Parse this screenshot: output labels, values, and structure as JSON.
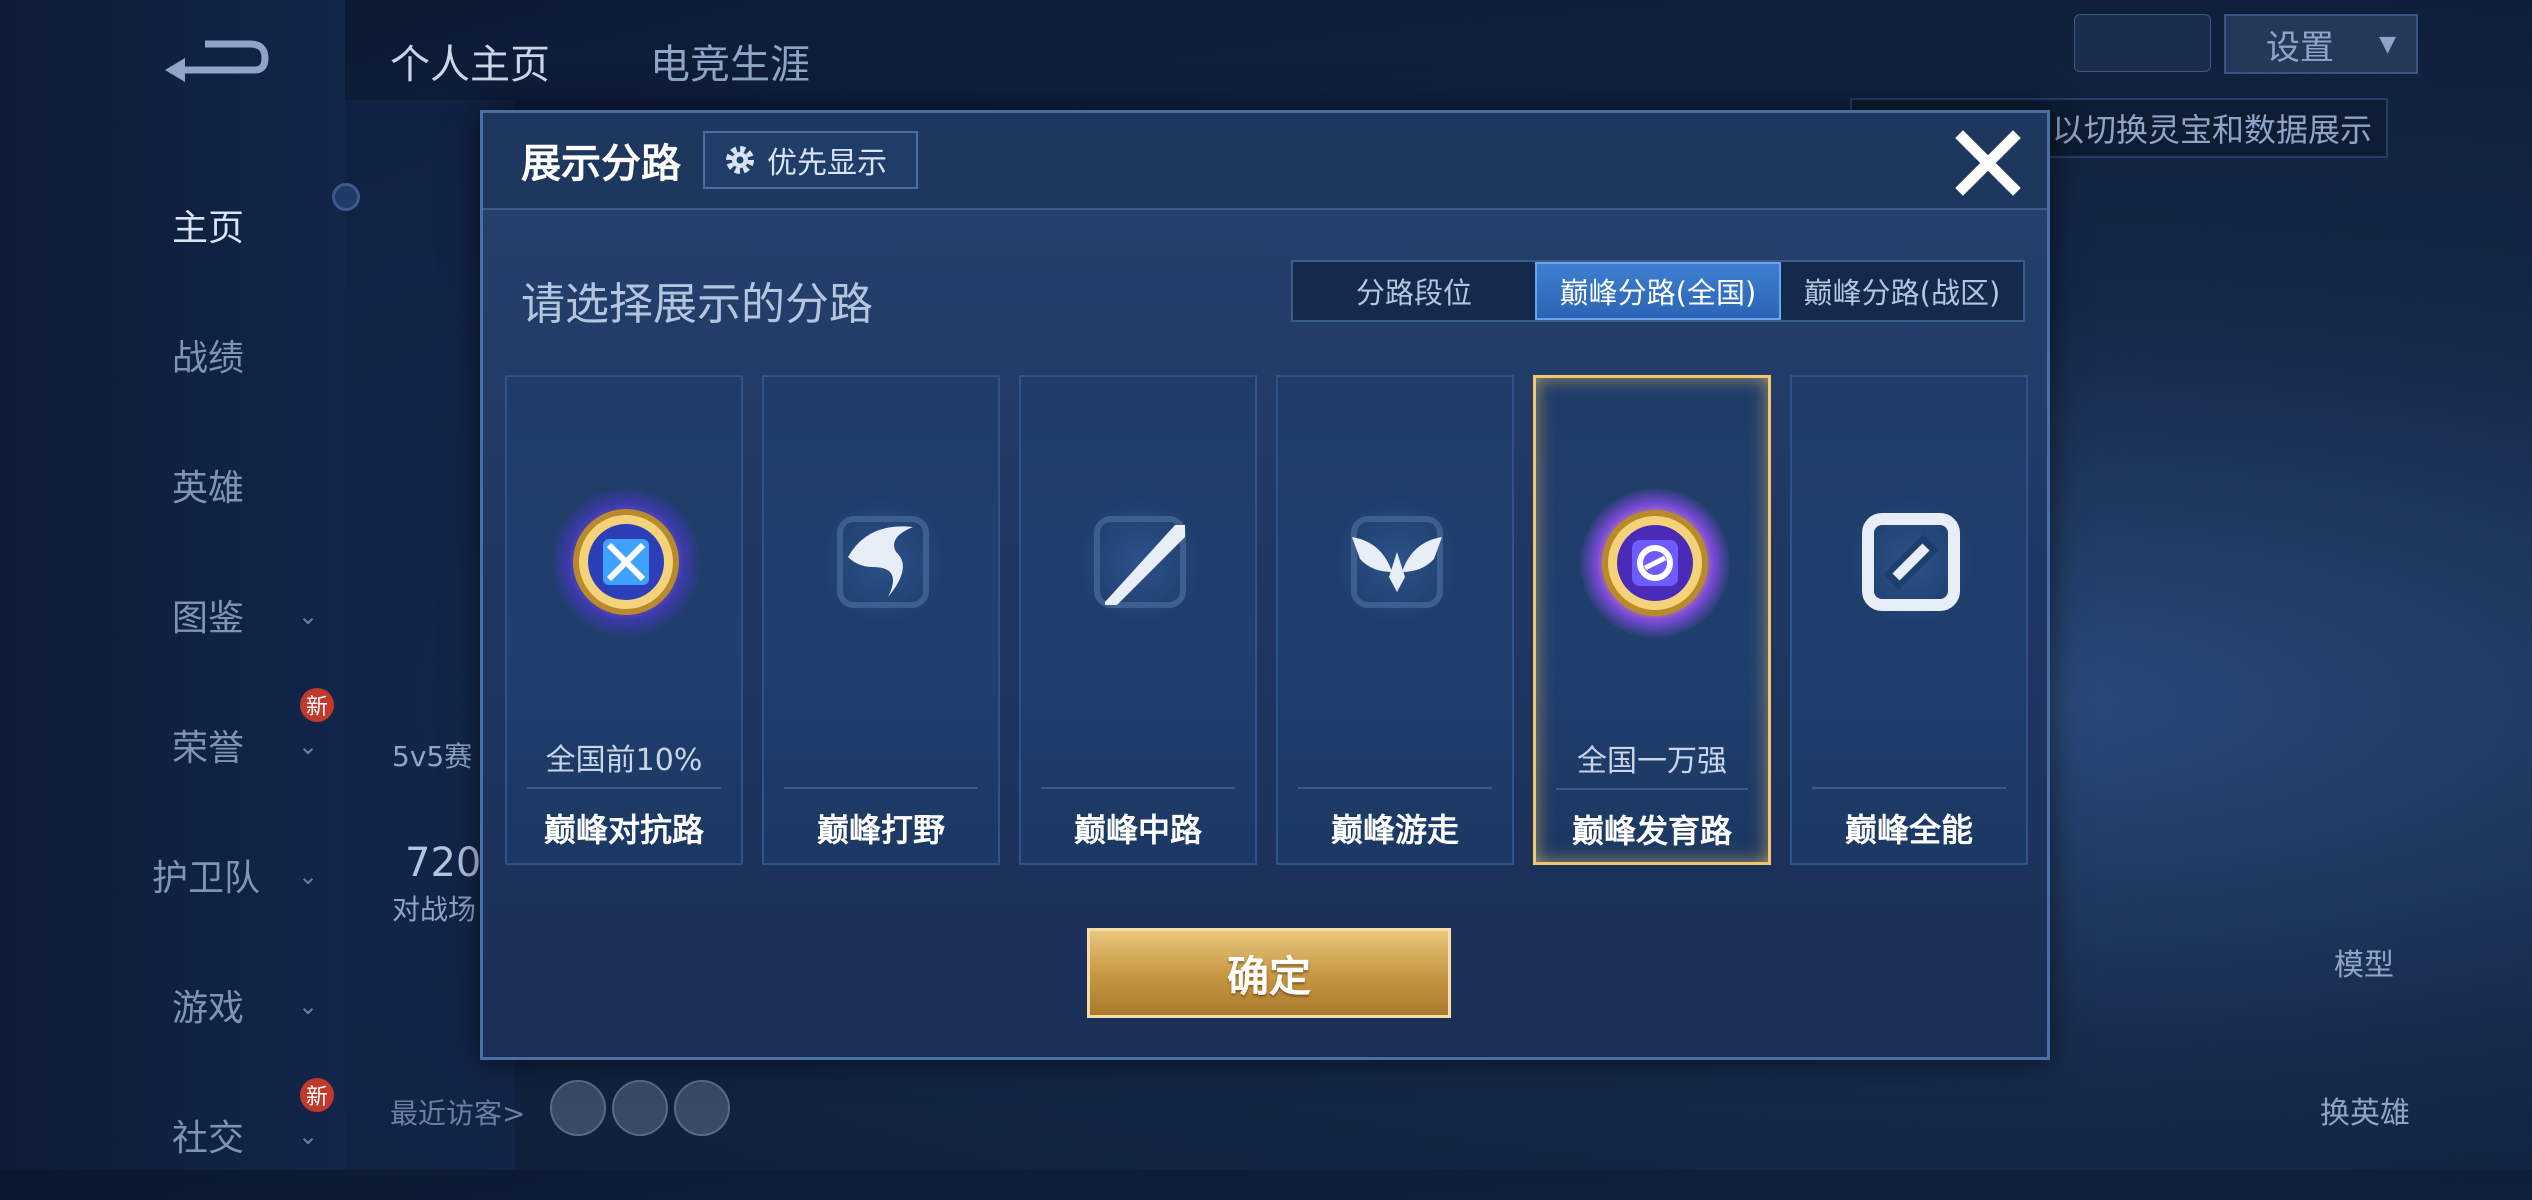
{
  "top_tabs": [
    "个人主页",
    "电竞生涯"
  ],
  "sidebar": {
    "items": [
      {
        "label": "主页",
        "active": true
      },
      {
        "label": "战绩"
      },
      {
        "label": "英雄"
      },
      {
        "label": "图鉴",
        "chevron": true
      },
      {
        "label": "荣誉",
        "chevron": true,
        "badge": "新"
      },
      {
        "label": "护卫队",
        "chevron": true
      },
      {
        "label": "游戏",
        "chevron": true
      },
      {
        "label": "社交",
        "chevron": true,
        "badge": "新"
      }
    ]
  },
  "settings_label": "设置",
  "hint_text": "以切换灵宝和数据展示",
  "background_texts": {
    "mode": "5v5赛",
    "count": "720",
    "count_label": "对战场",
    "visitors": "最近访客>",
    "model": "模型",
    "change_hero": "换英雄"
  },
  "dialog": {
    "title": "展示分路",
    "priority_btn": "优先显示",
    "subtitle": "请选择展示的分路",
    "segments": [
      {
        "label": "分路段位",
        "active": false
      },
      {
        "label": "巅峰分路(全国)",
        "active": true
      },
      {
        "label": "巅峰分路(战区)",
        "active": false
      }
    ],
    "cards": [
      {
        "name": "巅峰对抗路",
        "rank": "全国前10%",
        "medal": "glow",
        "selected": false
      },
      {
        "name": "巅峰打野",
        "rank": "",
        "medal": "plain",
        "selected": false
      },
      {
        "name": "巅峰中路",
        "rank": "",
        "medal": "plain",
        "selected": false
      },
      {
        "name": "巅峰游走",
        "rank": "",
        "medal": "plain",
        "selected": false
      },
      {
        "name": "巅峰发育路",
        "rank": "全国一万强",
        "medal": "gold",
        "selected": true
      },
      {
        "name": "巅峰全能",
        "rank": "",
        "medal": "plain",
        "selected": false
      }
    ],
    "confirm": "确定"
  },
  "colors": {
    "accent_blue": "#2c64b5",
    "gold": "#c89a45",
    "selected_border": "#f2c66e"
  }
}
